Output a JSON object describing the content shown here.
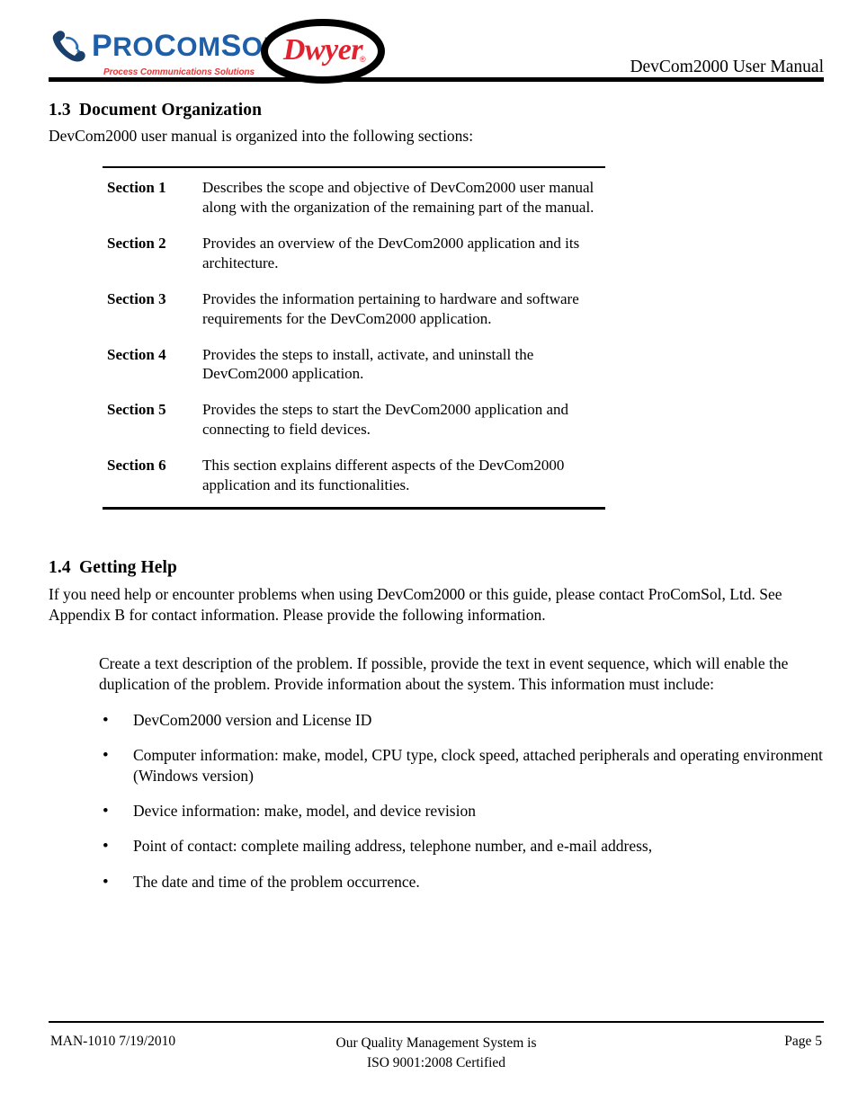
{
  "header": {
    "logo": {
      "brand": "ProComSol",
      "brand_parts": [
        "P",
        "RO",
        "C",
        "OM",
        "S",
        "OL"
      ],
      "tagline": "Process Communications Solutions",
      "phone_icon": "phone-handset-icon",
      "brand_color": "#1F5FA9",
      "tagline_color": "#E23A3A"
    },
    "partner_logo": {
      "brand": "Dwyer",
      "registered_mark": "®",
      "brand_color": "#E3222F",
      "oval_color": "#000000"
    },
    "title": "DevCom2000 User Manual"
  },
  "sections": {
    "doc_org": {
      "number": "1.3",
      "heading": "Document Organization",
      "intro": "DevCom2000 user manual is organized into the following sections:",
      "rows": [
        {
          "label": "Section 1",
          "description": "Describes the scope and objective of DevCom2000 user manual along with the organization of the remaining part of the manual."
        },
        {
          "label": "Section 2",
          "description": "Provides an overview of the DevCom2000 application and its architecture."
        },
        {
          "label": "Section 3",
          "description": "Provides the information pertaining to hardware and software requirements for the DevCom2000 application."
        },
        {
          "label": "Section 4",
          "description": "Provides the steps to install, activate, and uninstall the DevCom2000 application."
        },
        {
          "label": "Section 5",
          "description": "Provides the steps to start the DevCom2000 application and connecting to field devices."
        },
        {
          "label": "Section 6",
          "description": "This section explains different aspects of the DevCom2000 application and its functionalities."
        }
      ]
    },
    "getting_help": {
      "number": "1.4",
      "heading": "Getting Help",
      "paragraph1": "If you need help or encounter problems when using DevCom2000 or this guide, please contact ProComSol, Ltd.  See Appendix B for contact information.  Please provide the following information.",
      "paragraph2": "Create a text description of the problem.  If possible, provide the text in event sequence, which will enable the duplication of the problem.  Provide information about the system. This information must include:",
      "bullet_glyph": "•",
      "bullets": [
        "DevCom2000 version and License ID",
        "Computer information: make, model, CPU type, clock speed, attached peripherals and operating environment (Windows version)",
        "Device information: make, model, and device revision",
        "Point of contact: complete mailing address, telephone number, and e-mail address,",
        "The date and time of the problem occurrence."
      ]
    }
  },
  "footer": {
    "left": "MAN-1010 7/19/2010",
    "center_line1": "Our Quality Management System is",
    "center_line2": "ISO 9001:2008 Certified",
    "right": "Page 5"
  }
}
